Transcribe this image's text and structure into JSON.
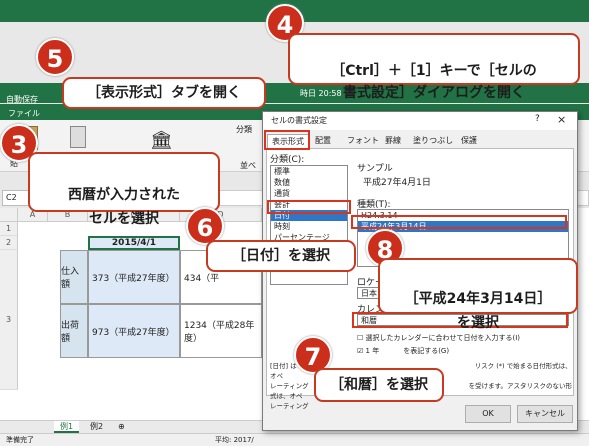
{
  "excel": {
    "autosave": "自動保存",
    "file_menu": "ファイル",
    "name_box": "C2",
    "titlebar_time": "時日 20:58",
    "ribbon_fragments": [
      "貼",
      "分類",
      "並べ"
    ],
    "sheet_tabs": [
      "例1",
      "例2"
    ],
    "status_left": "準備完了",
    "status_avg": "平均: 2017/",
    "row_headers": [
      "1",
      "2",
      "3"
    ],
    "col_headers": [
      "A",
      "B",
      "C",
      "D"
    ],
    "cells": {
      "date": "2015/4/1",
      "label_purchase": "仕入額",
      "val_purchase": "373（平成27年度）",
      "val_purchase_d": "434（平",
      "label_ship": "出荷額",
      "val_ship": "973（平成27年度）",
      "val_ship_d": "1234（平成28年度）"
    }
  },
  "dialog": {
    "title": "セルの書式設定",
    "close": "×",
    "help": "?",
    "tabs": [
      "表示形式",
      "配置",
      "フォント",
      "罫線",
      "塗りつぶし",
      "保護"
    ],
    "category_label": "分類(C):",
    "categories": [
      "標準",
      "数値",
      "通貨",
      "会計",
      "日付",
      "時刻",
      "パーセンテージ",
      "分数"
    ],
    "sample_label": "サンプル",
    "sample_value": "平成27年4月1日",
    "type_label": "種類(T):",
    "types": [
      "H24.3.14",
      "平成24年3月14日"
    ],
    "locale_label": "ロケール",
    "locale_value": "日本",
    "calendar_label": "カレン",
    "calendar_value": "和暦",
    "check_input": "選択したカレンダーに合わせて日付を入力する(I)",
    "check_first": "1 年",
    "check_first_tail": "を表記する(G)",
    "desc_line1": "[日付] は",
    "desc_line1_tail": "リスク (*) で始まる日付形式は、オペ",
    "desc_line2": "レーティング",
    "desc_line2_tail": "を受けます。アスタリスクのない形式は、オペ",
    "desc_line3": "レーティング",
    "ok": "OK",
    "cancel": "キャンセル"
  },
  "callouts": [
    {
      "num": "3",
      "text": "西暦が入力された\nセルを選択"
    },
    {
      "num": "4",
      "text": "［Ctrl］＋［1］キーで［セルの\n書式設定］ダイアログを開く"
    },
    {
      "num": "5",
      "text": "［表示形式］タブを開く"
    },
    {
      "num": "6",
      "text": "［日付］を選択"
    },
    {
      "num": "7",
      "text": "［和暦］を選択"
    },
    {
      "num": "8",
      "text": "［平成24年3月14日］\nを選択"
    }
  ],
  "colors": {
    "excel_green": "#217346",
    "callout_red": "#cc2e1c",
    "selection_blue": "#2f76c7"
  }
}
